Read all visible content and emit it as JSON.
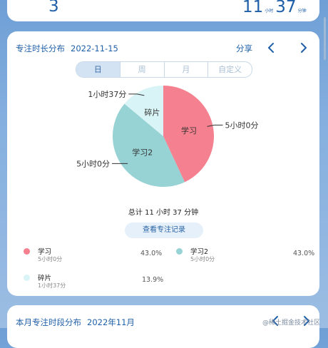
{
  "top": {
    "count": "3",
    "hours": "11",
    "hours_unit": "小时",
    "minutes": "37",
    "minutes_unit": "分钟"
  },
  "main": {
    "title": "专注时长分布",
    "date": "2022-11-15",
    "share_label": "分享",
    "segments": [
      "日",
      "周",
      "月",
      "自定义"
    ],
    "selected_segment": "日",
    "total": "总计 11 小时 37 分钟",
    "view_button": "查看专注记录"
  },
  "chart_data": {
    "type": "pie",
    "slices": [
      {
        "name": "学习",
        "label": "5小时0分",
        "percent": 43.0,
        "color": "#f5808f"
      },
      {
        "name": "学习2",
        "label": "5小时0分",
        "percent": 43.0,
        "color": "#97d2d4"
      },
      {
        "name": "碎片",
        "label": "1小时37分",
        "percent": 13.9,
        "color": "#d9f4f6"
      }
    ]
  },
  "legend": [
    {
      "name": "学习",
      "duration": "5小时0分",
      "percent": "43.0%",
      "color": "#f5808f"
    },
    {
      "name": "学习2",
      "duration": "5小时0分",
      "percent": "43.0%",
      "color": "#97d2d4"
    },
    {
      "name": "碎片",
      "duration": "1小时37分",
      "percent": "13.9%",
      "color": "#d9f4f6"
    }
  ],
  "bottom": {
    "title": "本月专注时段分布",
    "month": "2022年11月"
  },
  "watermark": "@稀土掘金技术社区",
  "icons": {
    "prev": "chevron-left-icon",
    "next": "chevron-right-icon"
  }
}
